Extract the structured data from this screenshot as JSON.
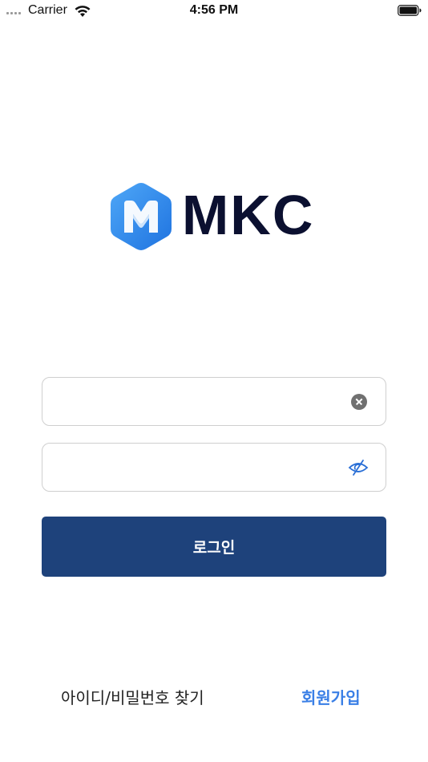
{
  "status_bar": {
    "carrier": "Carrier",
    "time": "4:56 PM",
    "icons": [
      "signal-icon",
      "wifi-icon",
      "battery-icon"
    ]
  },
  "logo": {
    "text": "MKC",
    "mark_colors": [
      "#2f8cf0",
      "#4ea7f7",
      "#ffffff"
    ],
    "text_color": "#0b1030"
  },
  "form": {
    "id_field": {
      "value": "",
      "placeholder": "",
      "icon": "clear-icon"
    },
    "password_field": {
      "value": "",
      "placeholder": "",
      "icon": "eye-slash-icon"
    },
    "login_label": "로그인",
    "login_color": "#1e427b"
  },
  "links": {
    "find_account": "아이디/비밀번호 찾기",
    "signup": "회원가입",
    "signup_color": "#3a7fe6"
  }
}
